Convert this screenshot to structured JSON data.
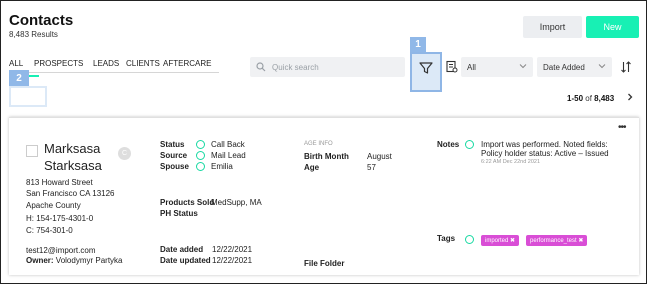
{
  "header": {
    "title": "Contacts",
    "results": "8,483 Results",
    "import_label": "Import",
    "new_label": "New"
  },
  "tabs": [
    "ALL",
    "PROSPECTS",
    "LEADS",
    "CLIENTS",
    "AFTERCARE"
  ],
  "search": {
    "placeholder": "Quick search"
  },
  "filters": {
    "scope_value": "All",
    "sort_value": "Date Added"
  },
  "callouts": {
    "one": "1",
    "two": "2"
  },
  "pagination": {
    "range": "1-50",
    "of": "of",
    "total": "8,483"
  },
  "contact": {
    "first_name": "Marksasa",
    "last_name": "Starksasa",
    "avatar_initial": "C",
    "address_line1": "813 Howard Street",
    "address_line2": "San Francisco CA 13126",
    "county": "Apache County",
    "home_phone": "H: 154-175-4301-0",
    "cell_phone": "C: 754-301-0",
    "email": "test12@import.com",
    "owner_label": "Owner:",
    "owner": "Volodymyr Partyka",
    "status_label": "Status",
    "status": "Call Back",
    "source_label": "Source",
    "source": "Mail Lead",
    "spouse_label": "Spouse",
    "spouse": "Emilia",
    "products_label": "Products Sold",
    "products": "MedSupp, MA",
    "ph_status_label": "PH Status",
    "date_added_label": "Date added",
    "date_added": "12/22/2021",
    "date_updated_label": "Date updated",
    "date_updated": "12/22/2021",
    "age_info_label": "AGE INFO",
    "birth_month_label": "Birth Month",
    "birth_month": "August",
    "age_label": "Age",
    "age": "57",
    "file_folder_label": "File Folder",
    "notes_label": "Notes",
    "note_text": "Import was performed. Noted fields: Policy holder status: Active – Issued",
    "note_time": "6:22 AM Dec 22nd 2021",
    "tags_label": "Tags",
    "tags": [
      "imported ✖",
      "performance_test ✖"
    ]
  },
  "colors": {
    "accent": "#18f0b4",
    "tag": "#d94ed6",
    "callout": "#90b8e8"
  },
  "icons": [
    "search-icon",
    "filter-icon",
    "document-icon",
    "chevron-down-icon",
    "sort-icon",
    "chevron-right-icon",
    "more-icon",
    "add-circle-icon"
  ]
}
